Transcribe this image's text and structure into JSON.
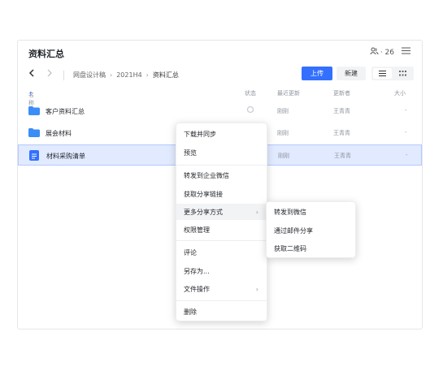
{
  "header": {
    "title": "资料汇总",
    "member_count": "· 26",
    "member_icon": "users-icon",
    "menu_icon": "hamburger-icon"
  },
  "toolbar": {
    "back_icon": "chevron-left-icon",
    "forward_icon": "chevron-right-icon",
    "breadcrumbs": [
      "网盘设计稿",
      "2021H4",
      "资料汇总"
    ],
    "upload_label": "上传",
    "new_label": "新建"
  },
  "table": {
    "columns": [
      "名称",
      "状态",
      "最近更新",
      "更新者",
      "大小"
    ],
    "rows": [
      {
        "name": "客户资料汇总",
        "type": "folder",
        "updated": "刚刚",
        "updater": "王青青",
        "size": "-"
      },
      {
        "name": "展会材料",
        "type": "folder",
        "updated": "刚刚",
        "updater": "王青青",
        "size": "-"
      },
      {
        "name": "材料采购清单",
        "type": "sheet",
        "updated": "刚刚",
        "updater": "王青青",
        "size": "-",
        "selected": true
      }
    ]
  },
  "context_menu": {
    "items": [
      "下载并同步",
      "预览",
      "转发到企业微信",
      "获取分享链接",
      "更多分享方式",
      "权限管理",
      "评论",
      "另存为...",
      "文件操作",
      "删除"
    ]
  },
  "submenu": {
    "items": [
      "转发到微信",
      "通过邮件分享",
      "获取二维码"
    ]
  },
  "colors": {
    "accent": "#3370ff",
    "folder": "#3a8ef6",
    "selected_row": "#e1eaff"
  }
}
